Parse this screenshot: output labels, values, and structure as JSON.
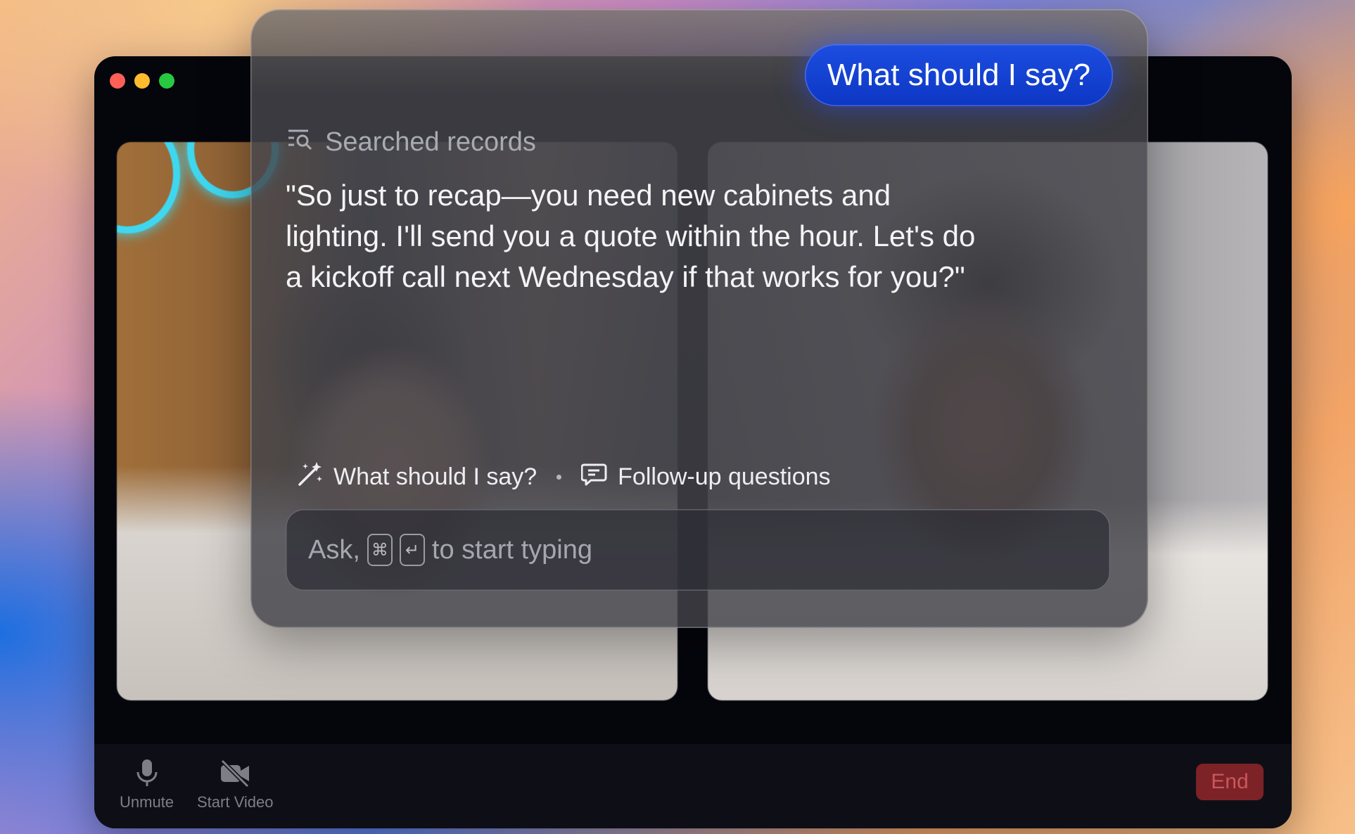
{
  "meeting_window": {
    "toolbar": {
      "unmute_label": "Unmute",
      "start_video_label": "Start Video",
      "end_label": "End"
    }
  },
  "assistant": {
    "user_prompt": "What should I say?",
    "status_label": "Searched records",
    "answer": "\"So just to recap—you need new cabinets and lighting. I'll send you a quote within the hour. Let's do a kickoff call next Wednesday if that works for you?\"",
    "suggestions": [
      {
        "label": "What should I say?",
        "icon": "magic-wand-icon"
      },
      {
        "label": "Follow-up questions",
        "icon": "chat-question-icon"
      }
    ],
    "input": {
      "prefix": "Ask,",
      "keys": [
        "⌘",
        "↵"
      ],
      "suffix": "to start typing"
    }
  },
  "colors": {
    "bubble_blue": "#1444d8",
    "end_red": "#7d2226"
  }
}
